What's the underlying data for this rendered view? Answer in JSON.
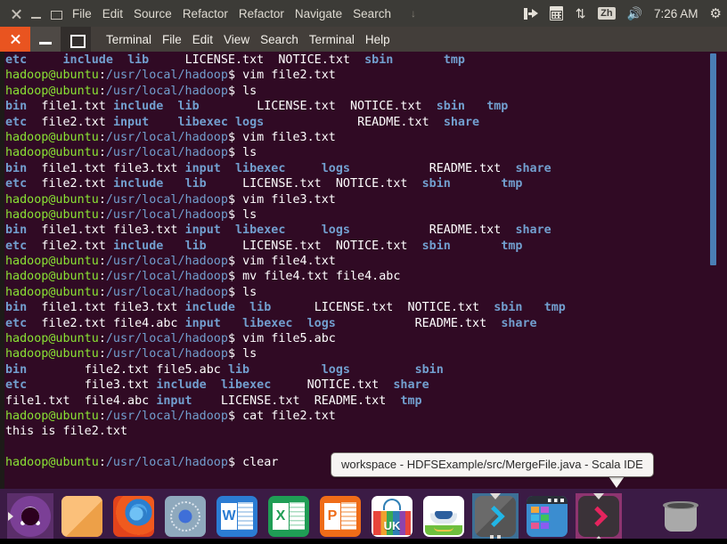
{
  "top_panel": {
    "window_controls": [
      "close",
      "minimize",
      "maximize"
    ],
    "menu": [
      "File",
      "Edit",
      "Source",
      "Refactor",
      "Refactor",
      "Navigate",
      "Search"
    ],
    "overflow_arrow": "↓",
    "indicators": {
      "messaging_icon": "messaging-icon",
      "calendar_icon": "calendar-icon",
      "network_icon": "network-up-down-icon",
      "keyboard_layout": "Zh",
      "volume_icon": "volume-icon",
      "clock": "7:26 AM",
      "session_icon": "gear-icon"
    }
  },
  "terminal_window": {
    "title_controls": [
      "close",
      "minimize",
      "maximize"
    ],
    "menu": [
      "Terminal",
      "File",
      "Edit",
      "View",
      "Search",
      "Terminal",
      "Help"
    ],
    "colors": {
      "background": "#300a24",
      "prompt_user": "#8ae234",
      "prompt_path": "#729fcf",
      "directory": "#729fcf",
      "text": "#ffffff",
      "scrollbar": "#4a7eb5"
    },
    "prompt": {
      "user_host": "hadoop@ubuntu",
      "separator": ":",
      "path": "/usr/local/hadoop",
      "sigil": "$"
    },
    "lines": [
      {
        "type": "ls",
        "cells": [
          {
            "t": "etc",
            "c": "dir",
            "w": 8
          },
          {
            "t": "include",
            "c": "dir",
            "w": 9
          },
          {
            "t": "lib",
            "c": "dir",
            "w": 8
          },
          {
            "t": "LICENSE.txt",
            "c": "file",
            "w": 13
          },
          {
            "t": "NOTICE.txt",
            "c": "file",
            "w": 12
          },
          {
            "t": "sbin",
            "c": "dir",
            "w": 11
          },
          {
            "t": "tmp",
            "c": "dir",
            "w": 4
          }
        ]
      },
      {
        "type": "cmd",
        "command": "vim file2.txt"
      },
      {
        "type": "cmd",
        "command": "ls"
      },
      {
        "type": "ls",
        "cells": [
          {
            "t": "bin",
            "c": "dir",
            "w": 5
          },
          {
            "t": "file1.txt",
            "c": "file",
            "w": 10
          },
          {
            "t": "include",
            "c": "dir",
            "w": 9
          },
          {
            "t": "lib",
            "c": "dir",
            "w": 11
          },
          {
            "t": "LICENSE.txt",
            "c": "file",
            "w": 13
          },
          {
            "t": "NOTICE.txt",
            "c": "file",
            "w": 12
          },
          {
            "t": "sbin",
            "c": "dir",
            "w": 7
          },
          {
            "t": "tmp",
            "c": "dir",
            "w": 4
          }
        ]
      },
      {
        "type": "ls",
        "cells": [
          {
            "t": "etc",
            "c": "dir",
            "w": 5
          },
          {
            "t": "file2.txt",
            "c": "file",
            "w": 10
          },
          {
            "t": "input",
            "c": "dir",
            "w": 9
          },
          {
            "t": "libexec",
            "c": "dir",
            "w": 8
          },
          {
            "t": "logs",
            "c": "dir",
            "w": 17
          },
          {
            "t": "README.txt",
            "c": "file",
            "w": 12
          },
          {
            "t": "share",
            "c": "dir",
            "w": 6
          }
        ]
      },
      {
        "type": "cmd",
        "command": "vim file3.txt"
      },
      {
        "type": "cmd",
        "command": "ls"
      },
      {
        "type": "ls",
        "cells": [
          {
            "t": "bin",
            "c": "dir",
            "w": 5
          },
          {
            "t": "file1.txt",
            "c": "file",
            "w": 10
          },
          {
            "t": "file3.txt",
            "c": "file",
            "w": 10
          },
          {
            "t": "input",
            "c": "dir",
            "w": 7
          },
          {
            "t": "libexec",
            "c": "dir",
            "w": 12
          },
          {
            "t": "logs",
            "c": "dir",
            "w": 15
          },
          {
            "t": "README.txt",
            "c": "file",
            "w": 12
          },
          {
            "t": "share",
            "c": "dir",
            "w": 6
          }
        ]
      },
      {
        "type": "ls",
        "cells": [
          {
            "t": "etc",
            "c": "dir",
            "w": 5
          },
          {
            "t": "file2.txt",
            "c": "file",
            "w": 10
          },
          {
            "t": "include",
            "c": "dir",
            "w": 10
          },
          {
            "t": "lib",
            "c": "dir",
            "w": 8
          },
          {
            "t": "LICENSE.txt",
            "c": "file",
            "w": 13
          },
          {
            "t": "NOTICE.txt",
            "c": "file",
            "w": 12
          },
          {
            "t": "sbin",
            "c": "dir",
            "w": 11
          },
          {
            "t": "tmp",
            "c": "dir",
            "w": 4
          }
        ]
      },
      {
        "type": "cmd",
        "command": "vim file3.txt"
      },
      {
        "type": "cmd",
        "command": "ls"
      },
      {
        "type": "ls",
        "cells": [
          {
            "t": "bin",
            "c": "dir",
            "w": 5
          },
          {
            "t": "file1.txt",
            "c": "file",
            "w": 10
          },
          {
            "t": "file3.txt",
            "c": "file",
            "w": 10
          },
          {
            "t": "input",
            "c": "dir",
            "w": 7
          },
          {
            "t": "libexec",
            "c": "dir",
            "w": 12
          },
          {
            "t": "logs",
            "c": "dir",
            "w": 15
          },
          {
            "t": "README.txt",
            "c": "file",
            "w": 12
          },
          {
            "t": "share",
            "c": "dir",
            "w": 6
          }
        ]
      },
      {
        "type": "ls",
        "cells": [
          {
            "t": "etc",
            "c": "dir",
            "w": 5
          },
          {
            "t": "file2.txt",
            "c": "file",
            "w": 10
          },
          {
            "t": "include",
            "c": "dir",
            "w": 10
          },
          {
            "t": "lib",
            "c": "dir",
            "w": 8
          },
          {
            "t": "LICENSE.txt",
            "c": "file",
            "w": 13
          },
          {
            "t": "NOTICE.txt",
            "c": "file",
            "w": 12
          },
          {
            "t": "sbin",
            "c": "dir",
            "w": 11
          },
          {
            "t": "tmp",
            "c": "dir",
            "w": 4
          }
        ]
      },
      {
        "type": "cmd",
        "command": "vim file4.txt"
      },
      {
        "type": "cmd",
        "command": "mv file4.txt file4.abc"
      },
      {
        "type": "cmd",
        "command": "ls"
      },
      {
        "type": "ls",
        "cells": [
          {
            "t": "bin",
            "c": "dir",
            "w": 5
          },
          {
            "t": "file1.txt",
            "c": "file",
            "w": 10
          },
          {
            "t": "file3.txt",
            "c": "file",
            "w": 10
          },
          {
            "t": "include",
            "c": "dir",
            "w": 9
          },
          {
            "t": "lib",
            "c": "dir",
            "w": 9
          },
          {
            "t": "LICENSE.txt",
            "c": "file",
            "w": 13
          },
          {
            "t": "NOTICE.txt",
            "c": "file",
            "w": 12
          },
          {
            "t": "sbin",
            "c": "dir",
            "w": 7
          },
          {
            "t": "tmp",
            "c": "dir",
            "w": 4
          }
        ]
      },
      {
        "type": "ls",
        "cells": [
          {
            "t": "etc",
            "c": "dir",
            "w": 5
          },
          {
            "t": "file2.txt",
            "c": "file",
            "w": 10
          },
          {
            "t": "file4.abc",
            "c": "file",
            "w": 10
          },
          {
            "t": "input",
            "c": "dir",
            "w": 8
          },
          {
            "t": "libexec",
            "c": "dir",
            "w": 9
          },
          {
            "t": "logs",
            "c": "dir",
            "w": 15
          },
          {
            "t": "README.txt",
            "c": "file",
            "w": 12
          },
          {
            "t": "share",
            "c": "dir",
            "w": 6
          }
        ]
      },
      {
        "type": "cmd",
        "command": "vim file5.abc"
      },
      {
        "type": "cmd",
        "command": "ls"
      },
      {
        "type": "ls",
        "cells": [
          {
            "t": "bin",
            "c": "dir",
            "w": 11
          },
          {
            "t": "file2.txt",
            "c": "file",
            "w": 10
          },
          {
            "t": "file5.abc",
            "c": "file",
            "w": 10
          },
          {
            "t": "lib",
            "c": "dir",
            "w": 13
          },
          {
            "t": "logs",
            "c": "dir",
            "w": 13
          },
          {
            "t": "sbin",
            "c": "dir",
            "w": 5
          }
        ]
      },
      {
        "type": "ls",
        "cells": [
          {
            "t": "etc",
            "c": "dir",
            "w": 11
          },
          {
            "t": "file3.txt",
            "c": "file",
            "w": 10
          },
          {
            "t": "include",
            "c": "dir",
            "w": 9
          },
          {
            "t": "libexec",
            "c": "dir",
            "w": 12
          },
          {
            "t": "NOTICE.txt",
            "c": "file",
            "w": 12
          },
          {
            "t": "share",
            "c": "dir",
            "w": 6
          }
        ]
      },
      {
        "type": "ls",
        "cells": [
          {
            "t": "file1.txt",
            "c": "file",
            "w": 11
          },
          {
            "t": "file4.abc",
            "c": "file",
            "w": 10
          },
          {
            "t": "input",
            "c": "dir",
            "w": 9
          },
          {
            "t": "LICENSE.txt",
            "c": "file",
            "w": 13
          },
          {
            "t": "README.txt",
            "c": "file",
            "w": 12
          },
          {
            "t": "tmp",
            "c": "dir",
            "w": 4
          }
        ]
      },
      {
        "type": "cmd",
        "command": "cat file2.txt"
      },
      {
        "type": "out",
        "text": "this is file2.txt"
      },
      {
        "type": "blank"
      },
      {
        "type": "cmd",
        "command": "clear"
      }
    ]
  },
  "tooltip": {
    "text": "workspace - HDFSExample/src/MergeFile.java - Scala IDE"
  },
  "dock": {
    "items": [
      {
        "name": "ubuntu-dash",
        "icon": "ubuntu-logo-icon",
        "label": "Ubuntu Dash",
        "focused": true,
        "running": false
      },
      {
        "name": "files",
        "icon": "folder-icon",
        "label": "Files",
        "focused": false,
        "running": false
      },
      {
        "name": "firefox",
        "icon": "firefox-icon",
        "label": "Firefox Web Browser",
        "focused": false,
        "running": false
      },
      {
        "name": "amazon",
        "icon": "amazon-icon",
        "label": "Amazon",
        "focused": false,
        "running": false
      },
      {
        "name": "libreoffice-writer",
        "icon": "word-document-icon",
        "label": "Writer",
        "focused": false,
        "running": false
      },
      {
        "name": "libreoffice-calc",
        "icon": "excel-spreadsheet-icon",
        "label": "Calc",
        "focused": false,
        "running": false
      },
      {
        "name": "libreoffice-impress",
        "icon": "powerpoint-presentation-icon",
        "label": "Impress",
        "focused": false,
        "running": false
      },
      {
        "name": "software-center",
        "icon": "ubuntu-software-icon",
        "label": "Ubuntu Software",
        "focused": false,
        "running": false
      },
      {
        "name": "help",
        "icon": "help-robot-icon",
        "label": "Ubuntu Help",
        "focused": false,
        "running": false
      },
      {
        "name": "scala-ide",
        "icon": "terminal-chevron-blue-icon",
        "label": "Scala IDE",
        "focused": true,
        "running": true
      },
      {
        "name": "app-grid",
        "icon": "window-tiles-icon",
        "label": "Applications",
        "focused": false,
        "running": false
      },
      {
        "name": "terminal",
        "icon": "terminal-chevron-red-icon",
        "label": "Terminal",
        "focused": true,
        "running": true
      },
      {
        "name": "trash",
        "icon": "trash-icon",
        "label": "Trash",
        "focused": false,
        "running": false
      }
    ]
  }
}
